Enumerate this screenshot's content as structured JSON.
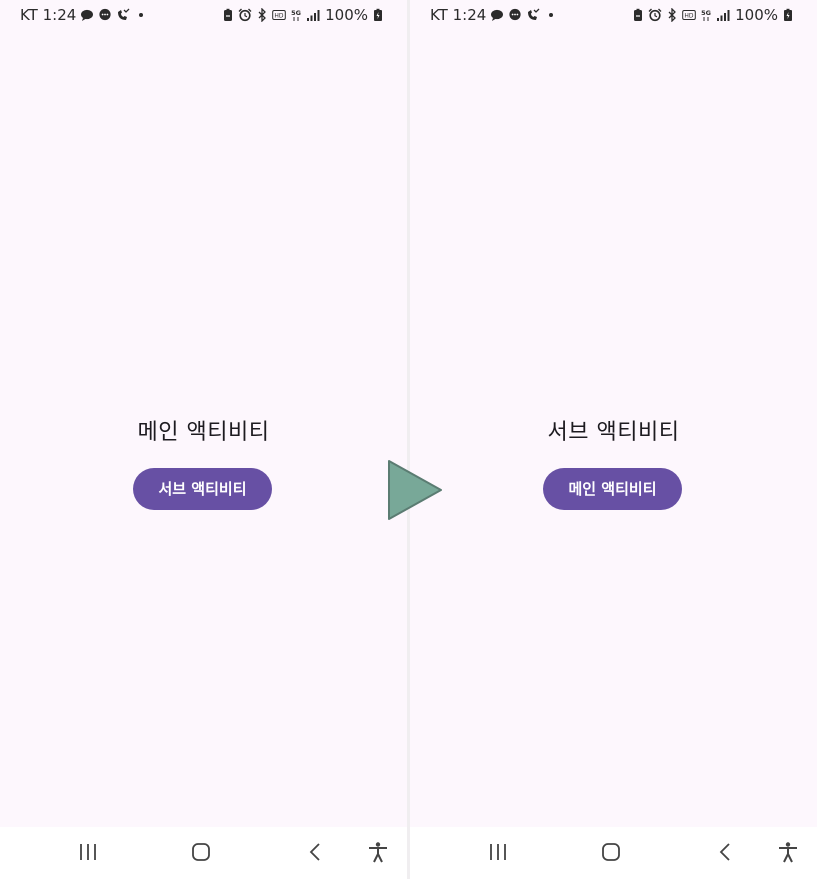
{
  "colors": {
    "screen_background": "#fdf7fd",
    "button_background": "#6750a4",
    "button_text": "#ffffff",
    "title_text": "#1d1b20",
    "arrow_fill": "#78a898",
    "arrow_stroke": "#5b7c72"
  },
  "left_screen": {
    "status_bar": {
      "carrier_time": "KT 1:24",
      "notification_icons": [
        "chat-bubble-icon",
        "message-icon",
        "phone-missed-icon",
        "dot-icon"
      ],
      "system_icons": [
        "battery-saver-icon",
        "alarm-icon",
        "bluetooth-icon",
        "hd-icon",
        "5g-icon",
        "signal-icon"
      ],
      "battery_text": "100%"
    },
    "title": "메인 액티비티",
    "button_label": "서브 액티비티"
  },
  "right_screen": {
    "status_bar": {
      "carrier_time": "KT 1:24",
      "notification_icons": [
        "chat-bubble-icon",
        "message-icon",
        "phone-missed-icon",
        "dot-icon"
      ],
      "system_icons": [
        "battery-saver-icon",
        "alarm-icon",
        "bluetooth-icon",
        "hd-icon",
        "5g-icon",
        "signal-icon"
      ],
      "battery_text": "100%"
    },
    "title": "서브 액티비티",
    "button_label": "메인 액티비티"
  },
  "nav_bar": {
    "icons": [
      "recents-icon",
      "home-icon",
      "back-icon",
      "accessibility-icon"
    ]
  },
  "transition_icon": "play-arrow-icon"
}
